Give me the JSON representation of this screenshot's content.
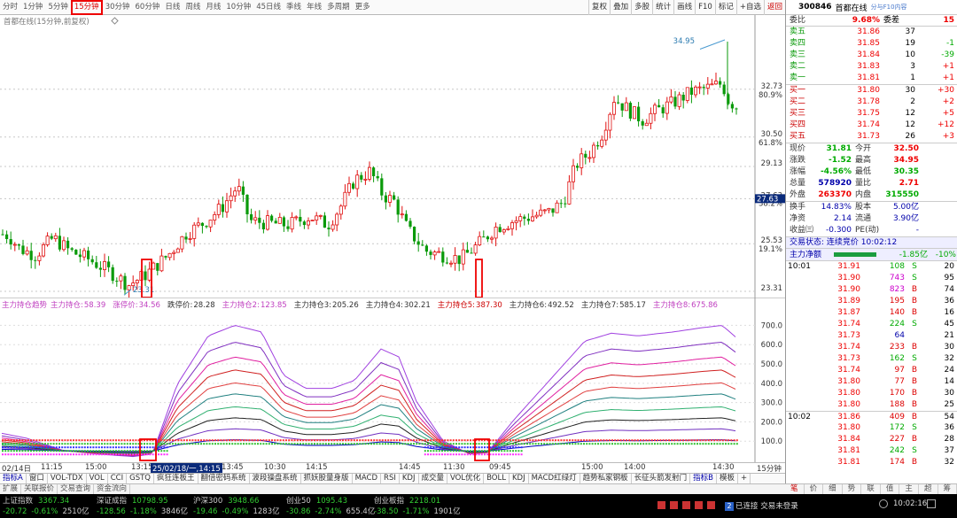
{
  "periods": [
    "分时",
    "1分钟",
    "5分钟",
    "15分钟",
    "30分钟",
    "60分钟",
    "日线",
    "周线",
    "月线",
    "10分钟",
    "45日线",
    "季线",
    "年线",
    "多周期",
    "更多"
  ],
  "active_period": "15分钟",
  "tools": [
    "复权",
    "叠加",
    "多股",
    "统计",
    "画线",
    "F10",
    "标记",
    "+自选",
    "返回"
  ],
  "chart_title": "首都在线(15分钟,前复权)",
  "price_axis": [
    "34.95",
    "32.73",
    "30.50",
    "29.13",
    "27.63",
    "25.53",
    "23.31"
  ],
  "pct_axis": [
    "80.9%",
    "61.8%",
    "38.2%",
    "19.1%"
  ],
  "high_label": "34.95",
  "low_label": "23.31",
  "current_tag": "27.63",
  "indicator": {
    "name": "主力持仓趋势",
    "items": [
      {
        "k": "主力持仓:",
        "v": "58.39",
        "c": "#c040c0"
      },
      {
        "k": "涨停价:",
        "v": "34.56",
        "c": "#c040c0"
      },
      {
        "k": "跌停价:",
        "v": "28.28",
        "c": "#333"
      },
      {
        "k": "主力持仓2:",
        "v": "123.85",
        "c": "#c040c0"
      },
      {
        "k": "主力持仓3:",
        "v": "205.26",
        "c": "#333"
      },
      {
        "k": "主力持仓4:",
        "v": "302.21",
        "c": "#333"
      },
      {
        "k": "主力持仓5:",
        "v": "387.30",
        "c": "#c00"
      },
      {
        "k": "主力持仓6:",
        "v": "492.52",
        "c": "#333"
      },
      {
        "k": "主力持仓7:",
        "v": "585.17",
        "c": "#333"
      },
      {
        "k": "主力持仓8:",
        "v": "675.86",
        "c": "#c040c0"
      }
    ]
  },
  "ind_axis": [
    "700.0",
    "600.0",
    "500.0",
    "400.0",
    "300.0",
    "200.0",
    "100.0"
  ],
  "dates": [
    {
      "t": "02/14日"
    },
    {
      "t": "11:15"
    },
    {
      "t": "15:00"
    },
    {
      "t": "13:15"
    },
    {
      "t": "13:45"
    },
    {
      "t": "10:30"
    },
    {
      "t": "14:15"
    },
    {
      "t": "14:45"
    },
    {
      "t": "11:30"
    },
    {
      "t": "09:45"
    },
    {
      "t": "15:00"
    },
    {
      "t": "14:00"
    },
    {
      "t": "14:30"
    }
  ],
  "date_highlight": "25/02/18/一,14:15",
  "period_label": "15分钟",
  "tabs1": [
    "指标A",
    "窗口",
    "VOL-TDX",
    "VOL",
    "CCI",
    "GSTQ",
    "疯狂连板王",
    "翻倍密码系统",
    "波段操盘系统",
    "抓妖股量身版",
    "MACD",
    "RSI",
    "KDJ",
    "成交量",
    "VOL优化",
    "BOLL",
    "KDJ",
    "MACD红绿灯",
    "趋势私家钢板",
    "长征头箭发射门",
    "指标B",
    "模板",
    "+"
  ],
  "tabs2": [
    "扩展",
    "关联报价",
    "交易查询",
    "资金流向"
  ],
  "side_tabs": [
    "笔",
    "价",
    "细",
    "势",
    "联",
    "值",
    "主",
    "超",
    "筹"
  ],
  "status": [
    {
      "n": "上证指数",
      "v": "3367.34",
      "c": "-20.72",
      "p": "-0.61%",
      "a": "2510亿"
    },
    {
      "n": "深证成指",
      "v": "10798.95",
      "c": "-128.56",
      "p": "-1.18%",
      "a": "3846亿"
    },
    {
      "n": "沪深300",
      "v": "3948.66",
      "c": "-19.46",
      "p": "-0.49%",
      "a": "1283亿"
    },
    {
      "n": "创业50",
      "v": "1095.43",
      "c": "-30.86",
      "p": "-2.74%",
      "a": "655.4亿"
    },
    {
      "n": "创业板指",
      "v": "2218.01",
      "c": "-38.50",
      "p": "-1.71%",
      "a": "1901亿"
    }
  ],
  "conn": "已连接 交易未登录",
  "clock": "10:02:16",
  "quote": {
    "code": "300846",
    "name": "首都在线",
    "tag": "分与F10内容",
    "weibi": "9.68%",
    "weicha": "15",
    "asks": [
      {
        "l": "卖五",
        "p": "31.86",
        "v": "37",
        "d": ""
      },
      {
        "l": "卖四",
        "p": "31.85",
        "v": "19",
        "d": "-1"
      },
      {
        "l": "卖三",
        "p": "31.84",
        "v": "10",
        "d": "-39"
      },
      {
        "l": "卖二",
        "p": "31.83",
        "v": "3",
        "d": "+1"
      },
      {
        "l": "卖一",
        "p": "31.81",
        "v": "1",
        "d": "+1"
      }
    ],
    "bids": [
      {
        "l": "买一",
        "p": "31.80",
        "v": "30",
        "d": "+30"
      },
      {
        "l": "买二",
        "p": "31.78",
        "v": "2",
        "d": "+2"
      },
      {
        "l": "买三",
        "p": "31.75",
        "v": "12",
        "d": "+5"
      },
      {
        "l": "买四",
        "p": "31.74",
        "v": "12",
        "d": "+12"
      },
      {
        "l": "买五",
        "p": "31.73",
        "v": "26",
        "d": "+3"
      }
    ],
    "stats": [
      {
        "a": "现价",
        "b": "31.81",
        "c": "今开",
        "d": "32.50"
      },
      {
        "a": "涨跌",
        "b": "-1.52",
        "c": "最高",
        "d": "34.95"
      },
      {
        "a": "涨幅",
        "b": "-4.56%",
        "c": "最低",
        "d": "30.35"
      },
      {
        "a": "总量",
        "b": "578920",
        "c": "量比",
        "d": "2.71"
      },
      {
        "a": "外盘",
        "b": "263370",
        "c": "内盘",
        "d": "315550"
      }
    ],
    "stats2": [
      {
        "a": "换手",
        "b": "14.83%",
        "c": "股本",
        "d": "5.00亿"
      },
      {
        "a": "净资",
        "b": "2.14",
        "c": "流通",
        "d": "3.90亿"
      },
      {
        "a": "收益㈢",
        "b": "-0.300",
        "c": "PE(动)",
        "d": "-"
      }
    ],
    "trade_state": "交易状态: 连续竞价 10:02:12",
    "net": {
      "label": "主力净额",
      "v": "-1.85亿",
      "p": "-10%"
    },
    "deals": [
      {
        "t": "10:01",
        "p": "31.91",
        "v": "108",
        "s": "S",
        "n": "20"
      },
      {
        "t": "",
        "p": "31.90",
        "v": "743",
        "s": "S",
        "n": "95"
      },
      {
        "t": "",
        "p": "31.90",
        "v": "823",
        "s": "B",
        "n": "74"
      },
      {
        "t": "",
        "p": "31.89",
        "v": "195",
        "s": "B",
        "n": "36"
      },
      {
        "t": "",
        "p": "31.87",
        "v": "140",
        "s": "B",
        "n": "16"
      },
      {
        "t": "",
        "p": "31.74",
        "v": "224",
        "s": "S",
        "n": "45"
      },
      {
        "t": "",
        "p": "31.73",
        "v": "64",
        "s": "",
        "n": "21"
      },
      {
        "t": "",
        "p": "31.74",
        "v": "233",
        "s": "B",
        "n": "30"
      },
      {
        "t": "",
        "p": "31.73",
        "v": "162",
        "s": "S",
        "n": "32"
      },
      {
        "t": "",
        "p": "31.74",
        "v": "97",
        "s": "B",
        "n": "24"
      },
      {
        "t": "",
        "p": "31.80",
        "v": "77",
        "s": "B",
        "n": "14"
      },
      {
        "t": "",
        "p": "31.80",
        "v": "170",
        "s": "B",
        "n": "30"
      },
      {
        "t": "",
        "p": "31.80",
        "v": "188",
        "s": "B",
        "n": "25"
      },
      {
        "t": "10:02",
        "p": "31.86",
        "v": "409",
        "s": "B",
        "n": "54"
      },
      {
        "t": "",
        "p": "31.80",
        "v": "172",
        "s": "S",
        "n": "36"
      },
      {
        "t": "",
        "p": "31.84",
        "v": "227",
        "s": "B",
        "n": "28"
      },
      {
        "t": "",
        "p": "31.81",
        "v": "242",
        "s": "S",
        "n": "37"
      },
      {
        "t": "",
        "p": "31.81",
        "v": "174",
        "s": "B",
        "n": "32"
      }
    ]
  }
}
